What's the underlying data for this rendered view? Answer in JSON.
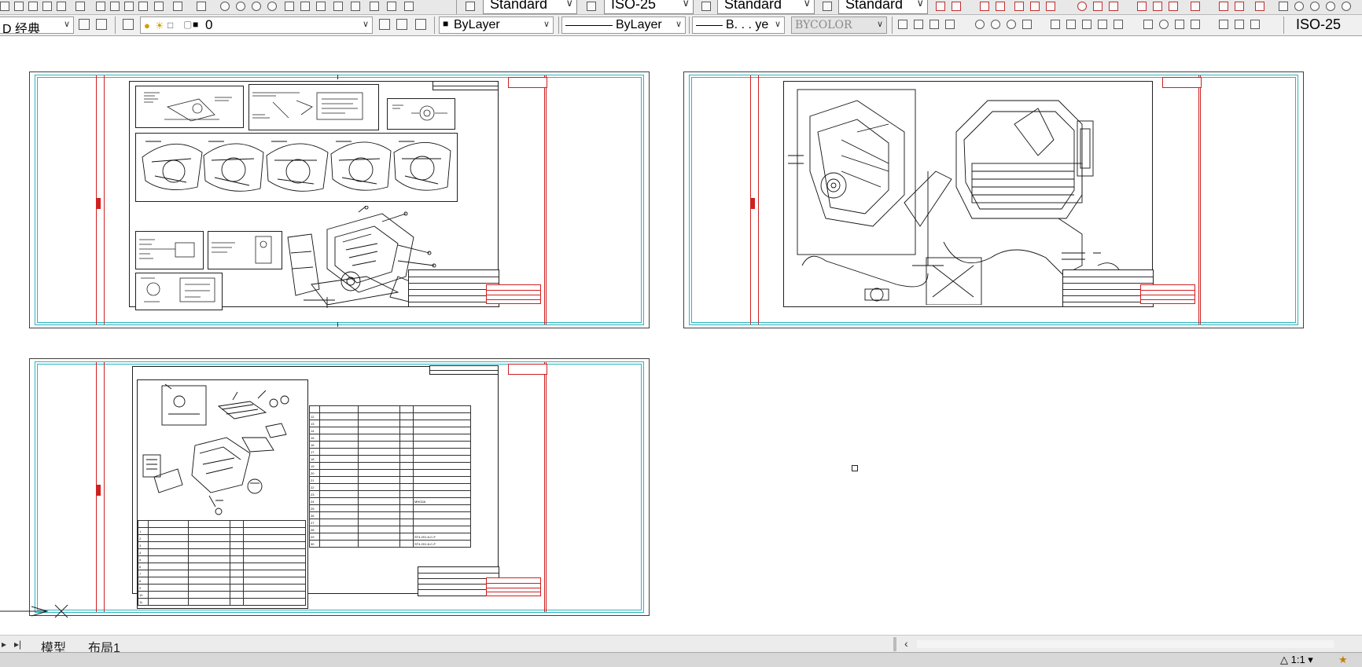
{
  "toolbar_top": {
    "text_style": "Standard",
    "dim_style": "ISO-25",
    "table_style": "Standard",
    "multileader_style": "Standard"
  },
  "toolbar_second": {
    "workspace": "D 经典",
    "layer": "0",
    "color": "ByLayer",
    "linetype": "ByLayer",
    "lineweight": "B. . . ye",
    "plotstyle": "BYCOLOR",
    "dim_style": "ISO-25"
  },
  "layout_tabs": [
    "模型",
    "布局1"
  ],
  "status": {
    "annotation_scale": "1:1"
  },
  "bom_left": {
    "rows": [
      "1",
      "2",
      "3",
      "4",
      "5",
      "6",
      "7",
      "8",
      "9",
      "10",
      "11"
    ]
  },
  "bom_right": {
    "rows": [
      "12",
      "13",
      "14",
      "15",
      "16",
      "17",
      "18",
      "19",
      "20",
      "21",
      "22",
      "23",
      "24",
      "25",
      "26",
      "27",
      "28",
      "29",
      "30"
    ],
    "note_1": "MHO2A",
    "note_2": "ST4.2X1.6-C-F"
  }
}
